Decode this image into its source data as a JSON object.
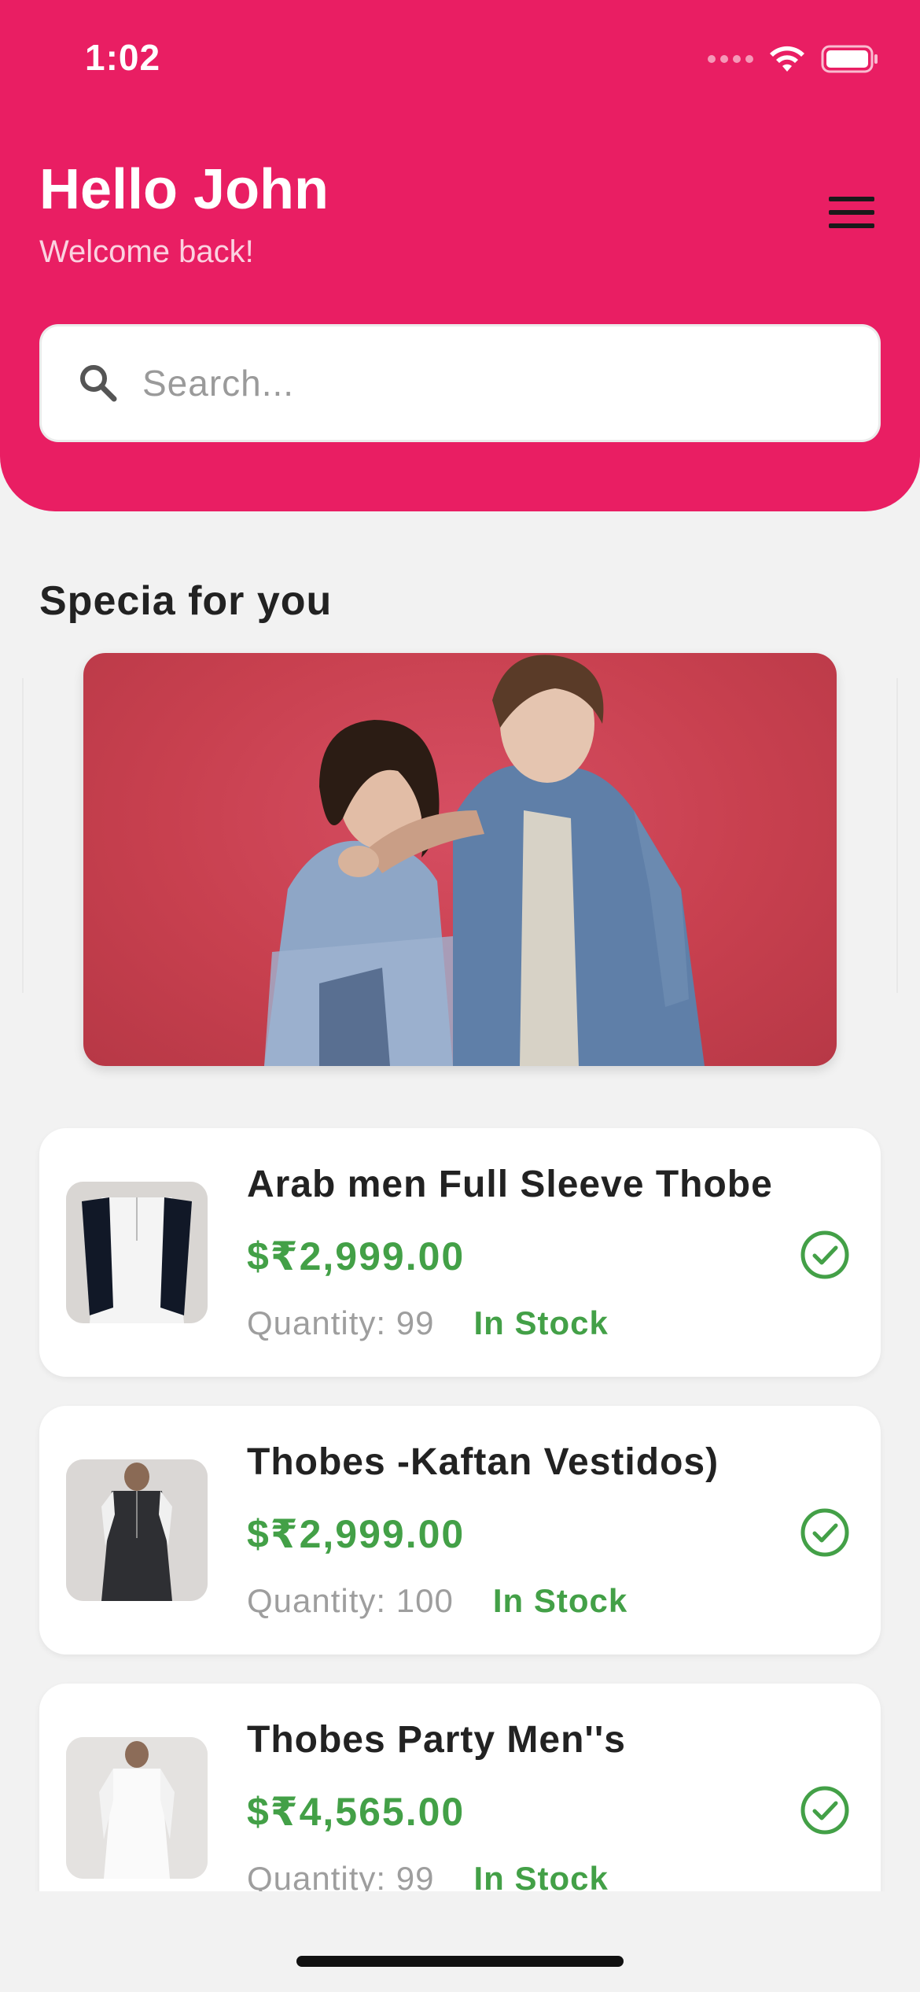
{
  "status_bar": {
    "time": "1:02"
  },
  "header": {
    "greeting": "Hello John",
    "subtitle": "Welcome back!",
    "menu_icon": "hamburger-menu-icon"
  },
  "search": {
    "placeholder": "Search...",
    "value": ""
  },
  "special_section": {
    "title": "Specia for you"
  },
  "products": [
    {
      "name": "Arab men Full Sleeve Thobe",
      "price": "$₹2,999.00",
      "quantity": "Quantity: 99",
      "stock": "In Stock"
    },
    {
      "name": "Thobes -Kaftan Vestidos)",
      "price": "$₹2,999.00",
      "quantity": "Quantity: 100",
      "stock": "In Stock"
    },
    {
      "name": "Thobes Party Men''s",
      "price": "$₹4,565.00",
      "quantity": "Quantity: 99",
      "stock": "In Stock"
    }
  ],
  "colors": {
    "accent": "#e91e63",
    "price": "#43a047",
    "background": "#f2f2f2"
  }
}
